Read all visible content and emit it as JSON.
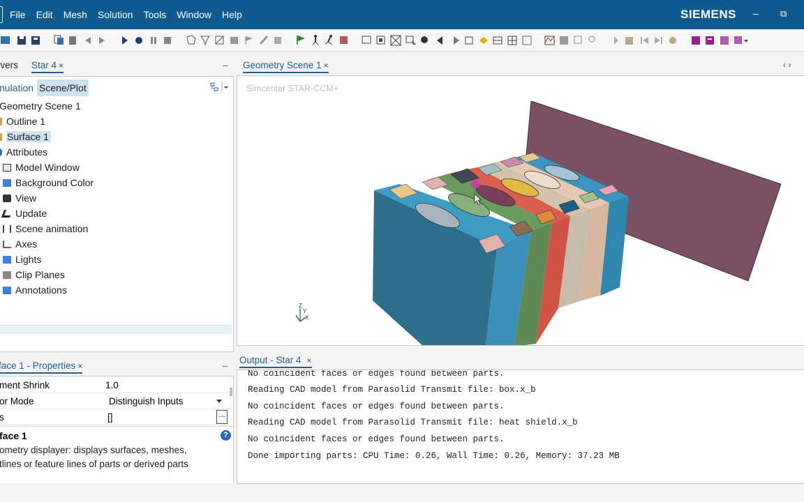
{
  "menubar": {
    "items": [
      "File",
      "Edit",
      "Mesh",
      "Solution",
      "Tools",
      "Window",
      "Help"
    ],
    "brand": "SIEMENS",
    "minimize_glyph": "–",
    "restore_glyph": "⧉"
  },
  "toolbar": {
    "icons": [
      "open-icon",
      "save-icon",
      "save-all-icon",
      "copy-icon",
      "paste-icon",
      "step-back-icon",
      "step-forward-icon",
      "run-icon",
      "record-icon",
      "pause-icon",
      "stop-icon",
      "mesh-icon",
      "filter-icon",
      "repair-icon",
      "clip-icon",
      "flag-gray-icon",
      "pen-icon",
      "surface-icon",
      "green-flag-icon",
      "walk-icon",
      "run-man-icon",
      "stop-red-icon",
      "screenshot-icon",
      "fit-icon",
      "zoom-box-icon",
      "select-icon",
      "lens-icon",
      "back-arrow-icon",
      "forward-arrow-icon",
      "cube-icon",
      "ruler-icon",
      "grid-a-icon",
      "grid-b-icon",
      "grid-c-icon",
      "plot-a-icon",
      "plot-b-icon",
      "plot-c-icon",
      "probe-icon",
      "play-small-icon",
      "stop-small-icon",
      "prev-frame-icon",
      "next-frame-icon",
      "record-small-icon",
      "report-a-icon",
      "report-b-icon",
      "macro-icon",
      "macro-menu-icon"
    ]
  },
  "left_panel": {
    "tabs": [
      {
        "label": "rvers"
      },
      {
        "label": "Star 4",
        "close": "×"
      }
    ],
    "minimize": "–",
    "subtabs": [
      "nulation",
      "Scene/Plot"
    ],
    "tree": [
      {
        "label": "Geometry Scene 1",
        "icon": "none"
      },
      {
        "label": "Outline 1",
        "icon": "outline-icon"
      },
      {
        "label": "Surface 1",
        "icon": "surface-icon",
        "selected": true
      },
      {
        "label": "Attributes",
        "icon": "attributes-icon"
      },
      {
        "label": "Model Window",
        "icon": "window-icon"
      },
      {
        "label": "Background Color",
        "icon": "folder-icon"
      },
      {
        "label": "View",
        "icon": "camera-icon"
      },
      {
        "label": "Update",
        "icon": "update-icon"
      },
      {
        "label": "Scene animation",
        "icon": "animation-icon"
      },
      {
        "label": "Axes",
        "icon": "axes-icon"
      },
      {
        "label": "Lights",
        "icon": "folder-icon"
      },
      {
        "label": "Clip Planes",
        "icon": "folder-gray-icon"
      },
      {
        "label": "Annotations",
        "icon": "folder-icon"
      }
    ]
  },
  "properties_panel": {
    "tab_label": "face 1 - Properties",
    "close": "×",
    "minimize": "–",
    "rows": [
      {
        "key": "ment Shrink",
        "value": "1.0"
      },
      {
        "key": "or Mode",
        "value": "Distinguish Inputs",
        "dropdown": true
      },
      {
        "key": "s",
        "value": "[]",
        "ellipsis": "..."
      }
    ],
    "description": {
      "title": "face 1",
      "help_glyph": "?",
      "lines": [
        "ometry displayer: displays surfaces, meshes,",
        "tlines or feature lines of parts or derived parts"
      ]
    }
  },
  "scene_panel": {
    "tab_label": "Geometry Scene 1",
    "close": "×",
    "nav_glyph": "‹ ›",
    "watermark": "Simcenter STAR-CCM+",
    "axis_triad": {
      "z": "Z",
      "y": "Y",
      "x": "X"
    }
  },
  "output_panel": {
    "tab_label": "Output - Star 4",
    "close": "×",
    "lines": [
      "No coincident faces or edges found between parts.",
      "Reading CAD model from Parasolid Transmit file: box.x_b",
      "No coincident faces or edges found between parts.",
      "Reading CAD model from Parasolid Transmit file: heat shield.x_b",
      "No coincident faces or edges found between parts.",
      "Done importing parts: CPU Time: 0.26, Wall Time: 0.26, Memory: 37.23 MB"
    ]
  },
  "colors": {
    "titlebar": "#0f5b8f",
    "accent": "#1f5f8f",
    "selection": "#cfe3ef",
    "heat_shield": "#7a5063",
    "cell_blue": "#3a8fb8",
    "cell_green": "#5f8a55",
    "cell_red": "#d35a4e",
    "cell_beige": "#d6b8a0"
  }
}
